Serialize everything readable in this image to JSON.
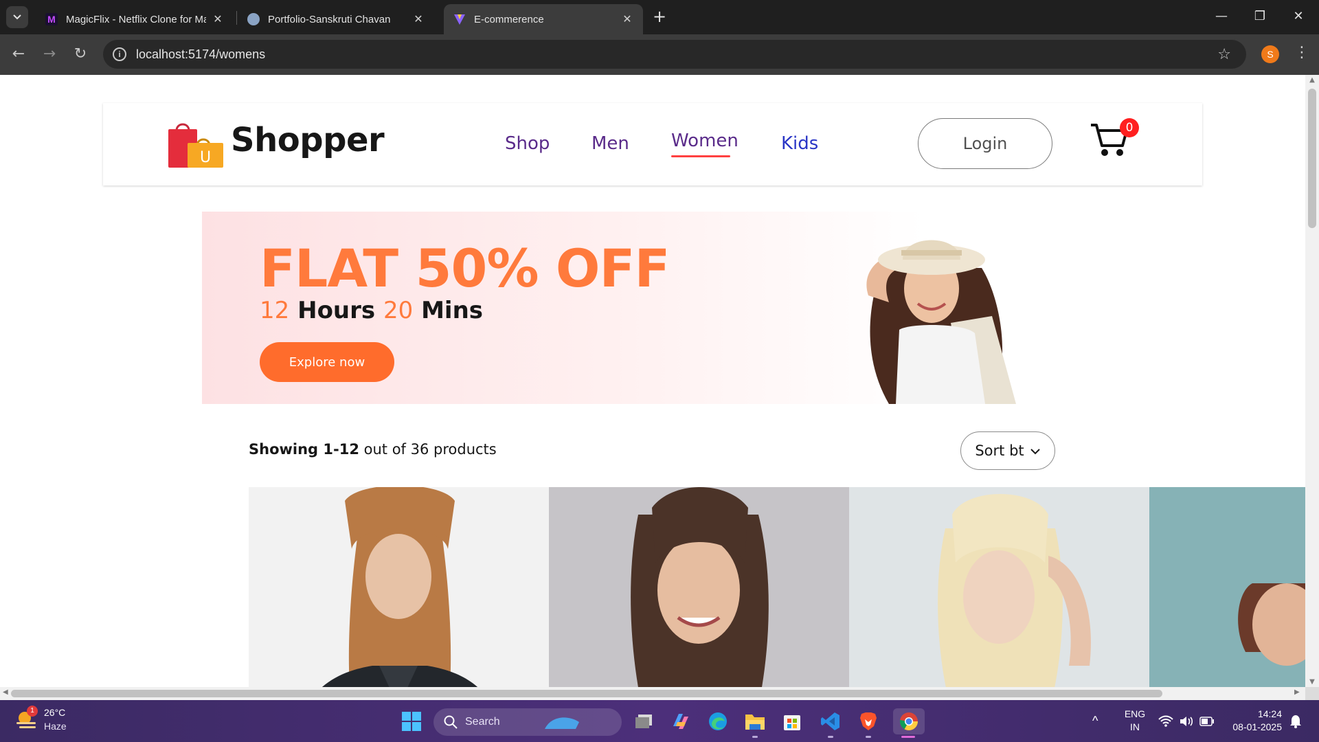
{
  "browser": {
    "tabs": [
      {
        "title": "MagicFlix - Netflix Clone for Ma",
        "active": false
      },
      {
        "title": "Portfolio-Sanskruti Chavan",
        "active": false
      },
      {
        "title": "E-commerence",
        "active": true
      }
    ],
    "url": "localhost:5174/womens",
    "profile_initial": "S"
  },
  "site": {
    "brand": "Shopper",
    "nav": [
      "Shop",
      "Men",
      "Women",
      "Kids"
    ],
    "active_nav": "Women",
    "login_label": "Login",
    "cart_count": "0"
  },
  "banner": {
    "headline": "FLAT 50% OFF",
    "hours_num": "12",
    "hours_label": "Hours",
    "mins_num": "20",
    "mins_label": "Mins",
    "cta": "Explore now"
  },
  "listing": {
    "showing_bold": "Showing 1-12",
    "showing_rest": " out of 36 products",
    "sort_label": "Sort bt"
  },
  "colors": {
    "accent": "#ff7a3c",
    "nav_link": "#5a2b8a",
    "active_underline": "#ff4141",
    "cart_badge": "#ff1f1f"
  },
  "taskbar": {
    "weather_temp": "26°C",
    "weather_desc": "Haze",
    "weather_badge": "1",
    "search_placeholder": "Search",
    "lang_top": "ENG",
    "lang_bottom": "IN",
    "time": "14:24",
    "date": "08-01-2025"
  }
}
